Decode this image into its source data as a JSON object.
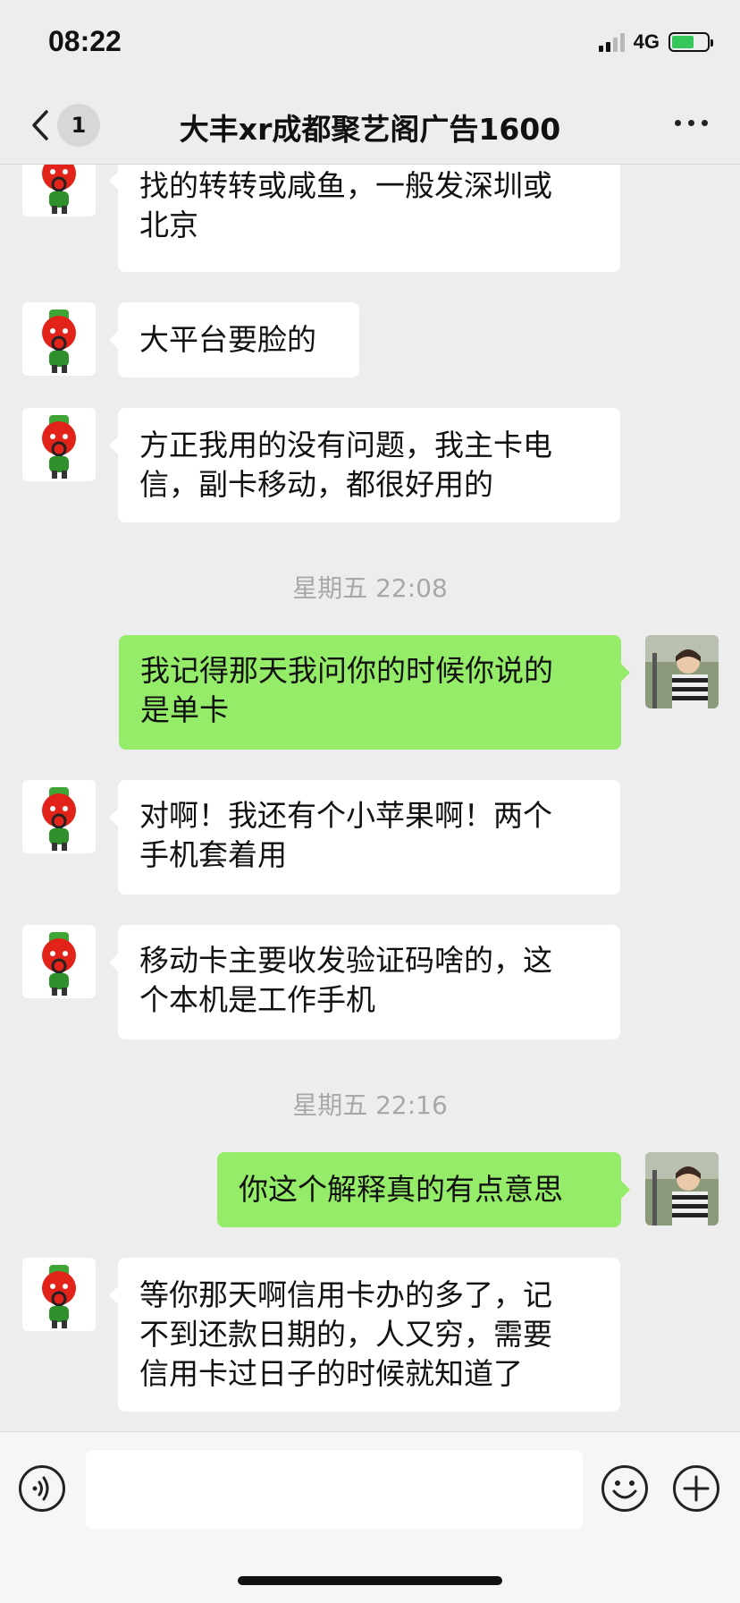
{
  "status_bar": {
    "time": "08:22",
    "network": "4G"
  },
  "header": {
    "unread_count": "1",
    "title": "大丰xr成都聚艺阁广告1600"
  },
  "messages": [
    {
      "lines": [
        "找的转转或咸鱼，一般发深圳或",
        "北京"
      ]
    },
    {
      "lines": [
        "大平台要脸的"
      ]
    },
    {
      "lines": [
        "方正我用的没有问题，我主卡电",
        "信，副卡移动，都很好用的"
      ]
    },
    {
      "timestamp": "星期五 22:08"
    },
    {
      "lines": [
        "我记得那天我问你的时候你说的",
        "是单卡"
      ]
    },
    {
      "lines": [
        "对啊！我还有个小苹果啊！两个",
        "手机套着用"
      ]
    },
    {
      "lines": [
        "移动卡主要收发验证码啥的，这",
        "个本机是工作手机"
      ]
    },
    {
      "timestamp": "星期五 22:16"
    },
    {
      "lines": [
        "你这个解释真的有点意思"
      ]
    },
    {
      "lines": [
        "等你那天啊信用卡办的多了，记",
        "不到还款日期的，人又穷，需要",
        "信用卡过日子的时候就知道了"
      ]
    }
  ],
  "input": {
    "value": ""
  },
  "colors": {
    "outgoing_bubble": "#95ec69",
    "incoming_bubble": "#ffffff",
    "background": "#ededed"
  }
}
